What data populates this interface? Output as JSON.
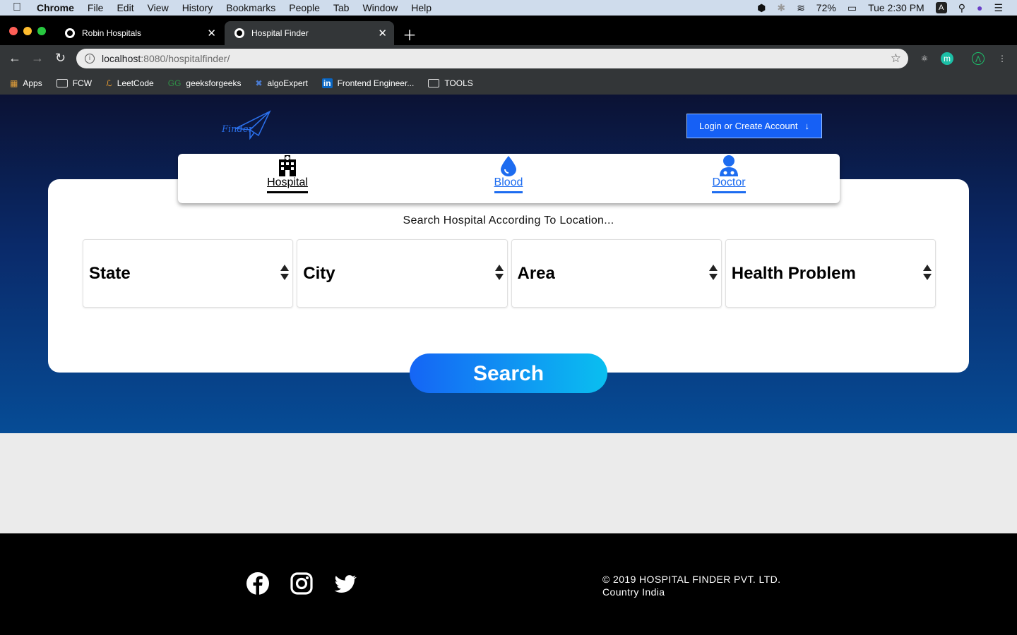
{
  "menubar": {
    "app": "Chrome",
    "items": [
      "File",
      "Edit",
      "View",
      "History",
      "Bookmarks",
      "People",
      "Tab",
      "Window",
      "Help"
    ],
    "battery": "72%",
    "clock": "Tue 2:30 PM",
    "input_badge": "A"
  },
  "tabs": [
    {
      "title": "Robin Hospitals"
    },
    {
      "title": "Hospital Finder"
    }
  ],
  "address": {
    "host": "localhost",
    "path": ":8080/hospitalfinder/"
  },
  "bookmarks": [
    "Apps",
    "FCW",
    "LeetCode",
    "geeksforgeeks",
    "algoExpert",
    "Frontend Engineer...",
    "TOOLS"
  ],
  "header": {
    "logo_text": "Finder",
    "login_label": "Login or Create Account"
  },
  "finder_tabs": [
    {
      "label": "Hospital"
    },
    {
      "label": "Blood"
    },
    {
      "label": "Doctor"
    }
  ],
  "search": {
    "title": "Search Hospital According To Location...",
    "selects": [
      "State",
      "City",
      "Area",
      "Health Problem"
    ],
    "button": "Search"
  },
  "footer": {
    "copyright": "© 2019 HOSPITAL FINDER PVT. LTD.",
    "country": "Country India"
  },
  "colors": {
    "accent": "#1d6cf0",
    "hero_top": "#0b1234",
    "hero_bottom": "#064c96"
  }
}
